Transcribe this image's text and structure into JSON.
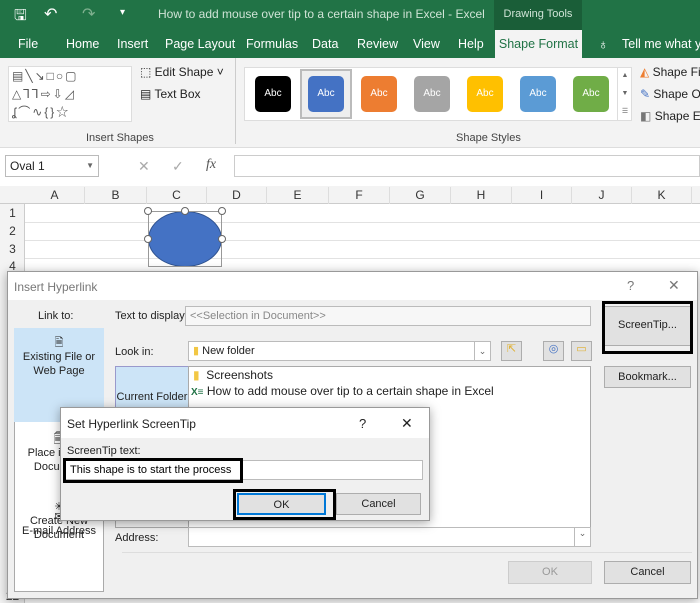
{
  "titlebar": {
    "title": "How to add mouse over tip to a certain shape in Excel  -  Excel",
    "context": "Drawing Tools"
  },
  "tabs": [
    "File",
    "Home",
    "Insert",
    "Page Layout",
    "Formulas",
    "Data",
    "Review",
    "View",
    "Help",
    "Shape Format"
  ],
  "tell_me": "Tell me what you",
  "ribbon": {
    "edit_shape": "Edit Shape",
    "text_box": "Text Box",
    "insert_shapes": "Insert Shapes",
    "shape_styles": "Shape Styles",
    "swatch_label": "Abc",
    "swatch_colors": [
      "#000000",
      "#4472c4",
      "#ed7d31",
      "#a5a5a5",
      "#ffc000",
      "#5b9bd5",
      "#70ad47"
    ],
    "shape_fill": "Shape Fill",
    "shape_outline": "Shape Outline",
    "shape_effects": "Shape Effects"
  },
  "formula": {
    "name_box": "Oval 1",
    "fx": "fx"
  },
  "columns": [
    "A",
    "B",
    "C",
    "D",
    "E",
    "F",
    "G",
    "H",
    "I",
    "J",
    "K"
  ],
  "rows": [
    "1",
    "2",
    "3",
    "4"
  ],
  "row_bottom": "22",
  "shape_color": "#4472c4",
  "hyperlink": {
    "title": "Insert Hyperlink",
    "link_to": "Link to:",
    "link_items": [
      "Existing File or Web Page",
      "Place in This Document",
      "Create New Document",
      "E-mail Address"
    ],
    "text_to_display_label": "Text to display:",
    "text_to_display": "<<Selection in Document>>",
    "screentip_btn": "ScreenTip...",
    "look_in_label": "Look in:",
    "look_in": "New folder",
    "current_folder": "Current Folder",
    "files": [
      "Screenshots",
      "How to add mouse over tip to a certain shape in Excel"
    ],
    "bookmark": "Bookmark...",
    "address_label": "Address:",
    "ok": "OK",
    "cancel": "Cancel"
  },
  "screentip": {
    "title": "Set Hyperlink ScreenTip",
    "label": "ScreenTip text:",
    "value": "This shape is to start the process",
    "ok": "OK",
    "cancel": "Cancel"
  }
}
